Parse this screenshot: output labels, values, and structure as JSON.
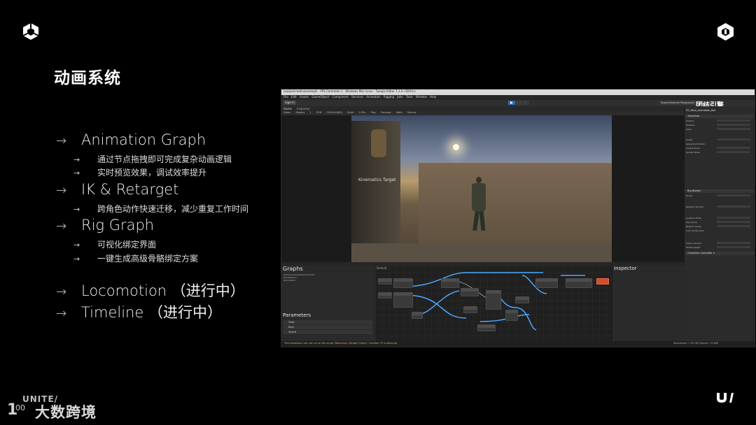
{
  "slide": {
    "title": "动画系统",
    "bullets": [
      {
        "label": "Animation Graph",
        "children": [
          "通过节点拖拽即可完成复杂动画逻辑",
          "实时预览效果，调试效率提升"
        ]
      },
      {
        "label": "IK & Retarget",
        "children": [
          "跨角色动作快速迁移，减少重复工作时间"
        ]
      },
      {
        "label": "Rig Graph",
        "children": [
          "可视化绑定界面",
          "一键生成高级骨骼绑定方案"
        ]
      },
      {
        "label": "Locomotion （进行中）",
        "children": []
      },
      {
        "label": "Timeline （进行中）",
        "children": []
      }
    ],
    "arrow": "→",
    "watermark": {
      "unite": "UNITE/",
      "brand": "大数跨境",
      "mark": "1",
      "mark_num": "00"
    }
  },
  "editor": {
    "window_title": "tuanjie/creativeexample - FPS Controller 1 - Windows Mac Linux - Tuanjie Editor 1.1.0 <DX11>",
    "menu": [
      "File",
      "Edit",
      "Assets",
      "GameObject",
      "Component",
      "Services",
      "Animation Rigging",
      "Jobs",
      "Tools",
      "Window",
      "Help"
    ],
    "sign_in": "Sign in",
    "layout_label": "SuperUniversal Playground",
    "brand": "团结引擎",
    "tabs": {
      "game": "Game",
      "inspector": "Inspector"
    },
    "game_toolbar": [
      "Game",
      "Display 1",
      "FHD (1920x1080)",
      "Scale",
      "0.35x",
      "Play Focused",
      "Stats",
      "Gizmos"
    ],
    "viewport_label": "Kinematics Target",
    "graphs_title": "Graphs",
    "graph_items": [
      "CharacterGraphExperimental",
      "BlendEngine",
      "Parameters"
    ],
    "graph_area_label": "Default",
    "params_title": "Parameters",
    "params": [
      "Float",
      "Bool",
      "Speed"
    ],
    "inspector_title": "Inspector",
    "right_inspector": {
      "object_name": "FG_Hero_Animation_Bot",
      "components": [
        "Transform",
        "Rig Builder",
        "Character Controller 1"
      ],
      "rows": [
        "Position",
        "Rotation",
        "Scale",
        "Avatar",
        "Apply Root Motion",
        "Culling Mode",
        "Update Mode",
        "Bones",
        "Follow Camera",
        "Rotation Smooth",
        "Rotate Speed",
        "Collision Mode",
        "Top Clamp",
        "Bottom Clamp",
        "Lock Camera Pos"
      ]
    },
    "status_text": "This behaviour can not run on the script. Behaviour (Strobe) Object ' function 'R' is delaying",
    "status_right": "Allocations: 1.39 GB  Objects: 70,660"
  }
}
